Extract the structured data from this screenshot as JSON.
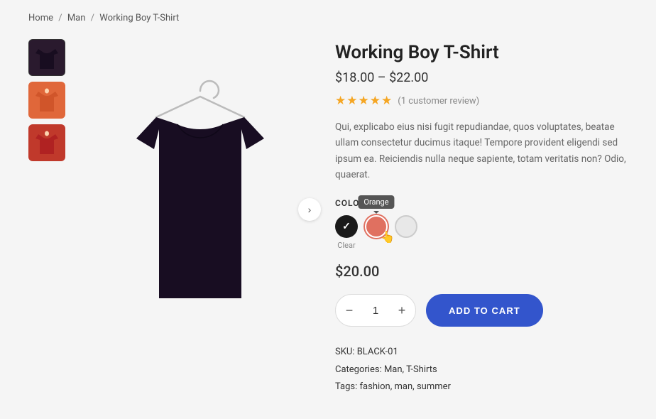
{
  "breadcrumb": {
    "items": [
      "Home",
      "Man",
      "Working Boy T-Shirt"
    ],
    "separators": [
      "/",
      "/"
    ]
  },
  "thumbnails": [
    {
      "id": "thumb-1",
      "color": "dark",
      "label": "Dark thumbnail",
      "active": true
    },
    {
      "id": "thumb-2",
      "color": "orange",
      "label": "Orange thumbnail",
      "active": false
    },
    {
      "id": "thumb-3",
      "color": "red",
      "label": "Red thumbnail",
      "active": false
    }
  ],
  "next_arrow": "›",
  "product": {
    "title": "Working Boy T-Shirt",
    "price_range": "$18.00 – $22.00",
    "selected_price": "$20.00",
    "review_count_text": "(1 customer review)",
    "description": "Qui, explicabo eius nisi fugit repudiandae, quos voluptates, beatae ullam consectetur ducimus itaque! Tempore provident eligendi sed ipsum ea. Reiciendis nulla neque sapiente, totam veritatis non? Odio, quaerat.",
    "color_label": "COLOR",
    "colors": [
      {
        "id": "black",
        "class": "black",
        "label": "Clear",
        "selected": true
      },
      {
        "id": "orange",
        "class": "orange",
        "label": "Orange",
        "hovered": true
      },
      {
        "id": "white",
        "class": "white",
        "label": "White",
        "selected": false
      }
    ],
    "clear_label": "Clear",
    "orange_tooltip": "Orange",
    "quantity": "1",
    "add_to_cart_label": "ADD TO CART",
    "sku_label": "SKU:",
    "sku_value": "BLACK-01",
    "categories_label": "Categories:",
    "categories_value": "Man, T-Shirts",
    "tags_label": "Tags:",
    "tags_value": "fashion, man, summer",
    "qty_minus": "−",
    "qty_plus": "+"
  },
  "icons": {
    "check": "✓",
    "star": "★"
  }
}
